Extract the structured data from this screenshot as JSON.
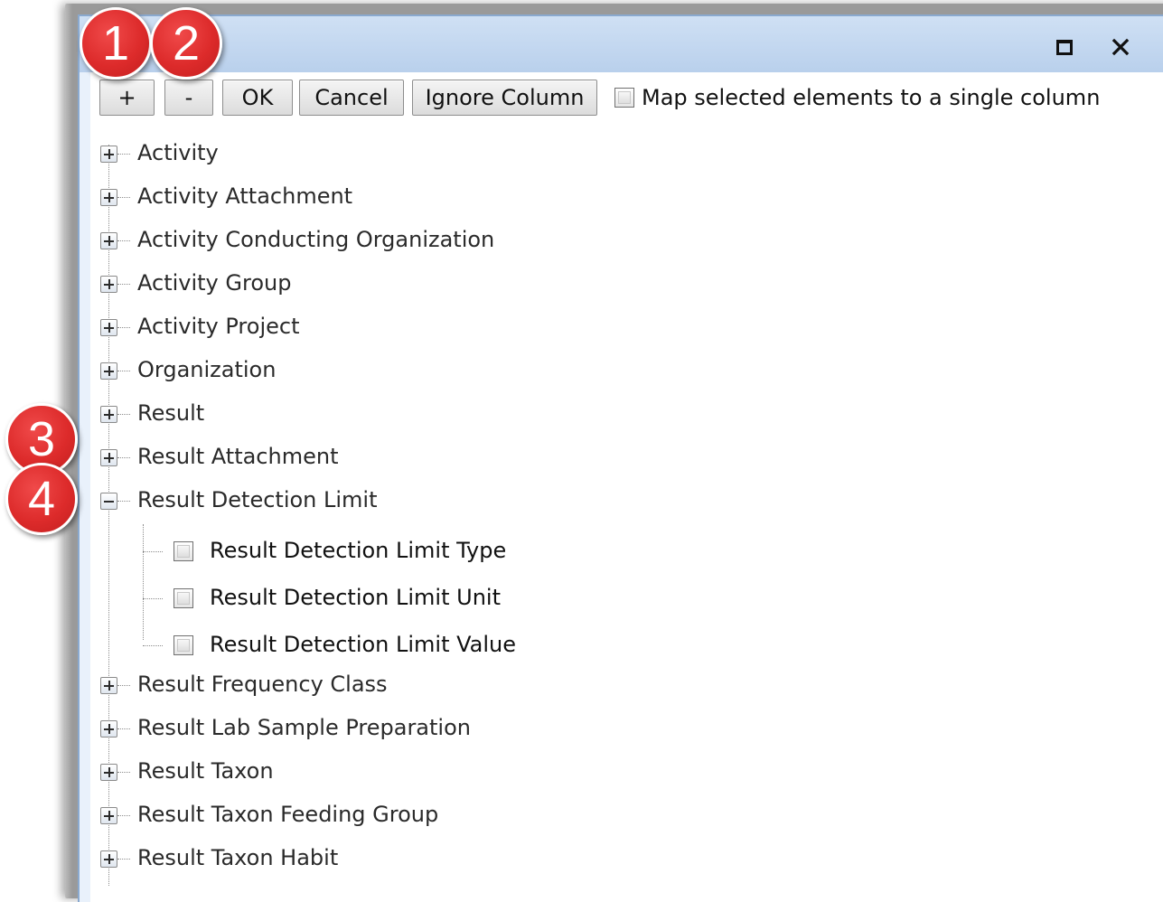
{
  "window": {
    "maximize_icon": "maximize-icon",
    "close_icon": "close-icon"
  },
  "toolbar": {
    "add_label": "+",
    "remove_label": "-",
    "ok_label": "OK",
    "cancel_label": "Cancel",
    "ignore_label": "Ignore Column",
    "map_single_label": "Map selected elements to a single column",
    "map_single_checked": false
  },
  "tree": {
    "nodes": [
      {
        "label": "Activity",
        "expanded": false
      },
      {
        "label": "Activity Attachment",
        "expanded": false
      },
      {
        "label": "Activity Conducting Organization",
        "expanded": false
      },
      {
        "label": "Activity Group",
        "expanded": false
      },
      {
        "label": "Activity Project",
        "expanded": false
      },
      {
        "label": "Organization",
        "expanded": false
      },
      {
        "label": "Result",
        "expanded": false
      },
      {
        "label": "Result Attachment",
        "expanded": false
      },
      {
        "label": "Result Detection Limit",
        "expanded": true
      },
      {
        "label": "Result Frequency Class",
        "expanded": false
      },
      {
        "label": "Result Lab Sample Preparation",
        "expanded": false
      },
      {
        "label": "Result Taxon",
        "expanded": false
      },
      {
        "label": "Result Taxon Feeding Group",
        "expanded": false
      },
      {
        "label": "Result Taxon Habit",
        "expanded": false
      }
    ],
    "expanded_children": [
      {
        "label": "Result Detection Limit Type",
        "checked": false
      },
      {
        "label": "Result Detection Limit Unit",
        "checked": false
      },
      {
        "label": "Result Detection Limit Value",
        "checked": false
      }
    ]
  },
  "callouts": [
    "1",
    "2",
    "3",
    "4"
  ],
  "colors": {
    "callout": "#dd2b2b",
    "titlebar": "#b9d0ec"
  }
}
